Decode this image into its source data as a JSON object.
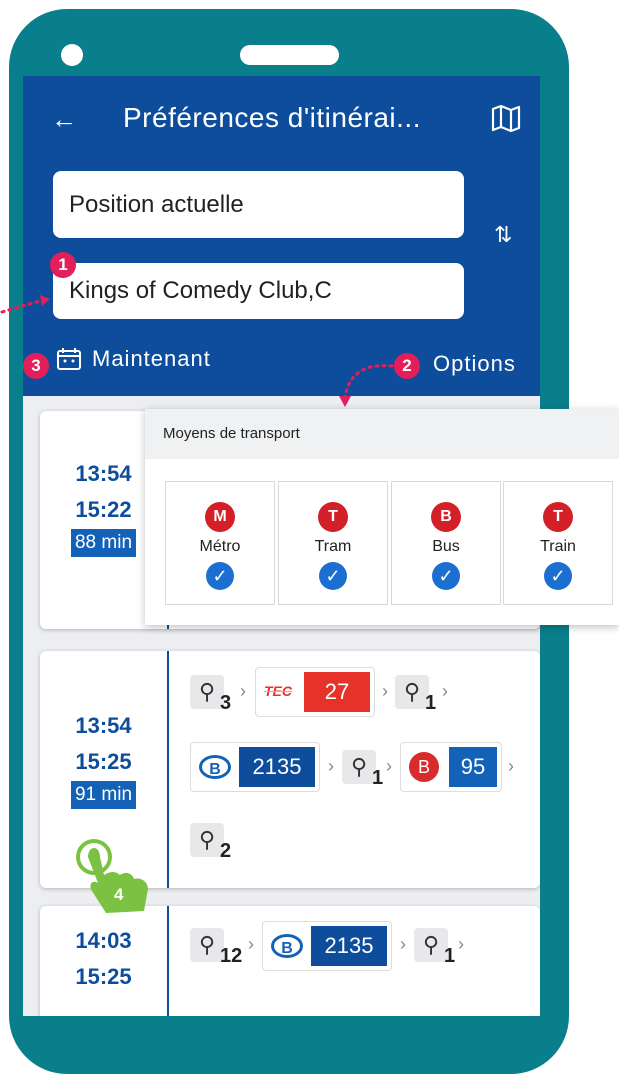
{
  "header": {
    "back_icon": "arrow-left-icon",
    "title": "Préférences d'itinérai...",
    "map_icon": "map-icon",
    "from_value": "Position actuelle",
    "to_value": "Kings of Comedy Club,C",
    "swap_icon": "swap-vertical-icon",
    "date_label": "Maintenant",
    "options_label": "Options"
  },
  "steps": [
    "1",
    "2",
    "3",
    "4"
  ],
  "transport_panel": {
    "title": "Moyens de transport",
    "modes": [
      {
        "badge": "M",
        "label": "Métro",
        "checked": true
      },
      {
        "badge": "T",
        "label": "Tram",
        "checked": true
      },
      {
        "badge": "B",
        "label": "Bus",
        "checked": true
      },
      {
        "badge": "T",
        "label": "Train",
        "checked": true
      }
    ]
  },
  "results": [
    {
      "depart": "13:54",
      "arrive": "15:22",
      "duration": "88 min"
    },
    {
      "depart": "13:54",
      "arrive": "15:25",
      "duration": "91 min",
      "walks": [
        "3",
        "1",
        "1",
        "2"
      ],
      "tec_line": "27",
      "tec_logo": "TEC",
      "train_line": "2135",
      "train_logo": "B",
      "bus_badge": "B",
      "bus_line": "95"
    },
    {
      "depart": "14:03",
      "arrive": "15:25",
      "walks": [
        "12",
        "1"
      ],
      "train_line": "2135",
      "train_logo": "B"
    }
  ],
  "colors": {
    "brand": "#0d4d9b",
    "frame": "#0a7f8c",
    "accent": "#e21f5a",
    "hand": "#7cc242"
  }
}
